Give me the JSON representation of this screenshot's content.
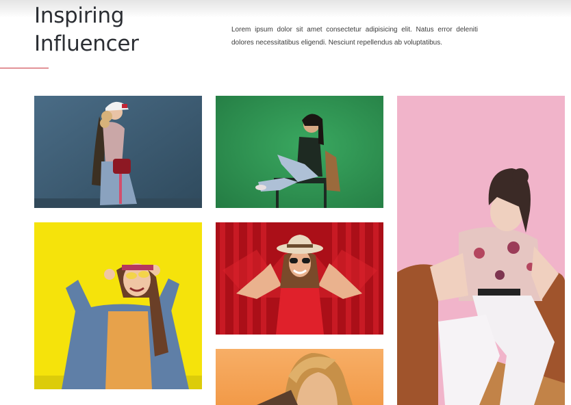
{
  "header": {
    "title_line1": "Inspiring",
    "title_line2": "Influencer",
    "intro": "Lorem ipsum dolor sit amet consectetur adipisicing elit. Natus error deleniti dolores necessitatibus eligendi. Nesciunt repellendus ab voluptatibus."
  },
  "colors": {
    "accent": "#c8313a",
    "title": "#2b2e33",
    "text": "#3a3a3a"
  },
  "gallery": {
    "photos": [
      {
        "name": "influencer-photo-blue-wall",
        "background": "#3e5d74"
      },
      {
        "name": "influencer-photo-green-backdrop",
        "background": "#2f9a52"
      },
      {
        "name": "influencer-photo-pink-chair",
        "background": "#f2b3c9"
      },
      {
        "name": "influencer-photo-yellow-wall",
        "background": "#f4e20e"
      },
      {
        "name": "influencer-photo-red-curtain",
        "background": "#b0111b"
      },
      {
        "name": "influencer-photo-orange-backdrop",
        "background": "#f6a55a"
      }
    ]
  }
}
